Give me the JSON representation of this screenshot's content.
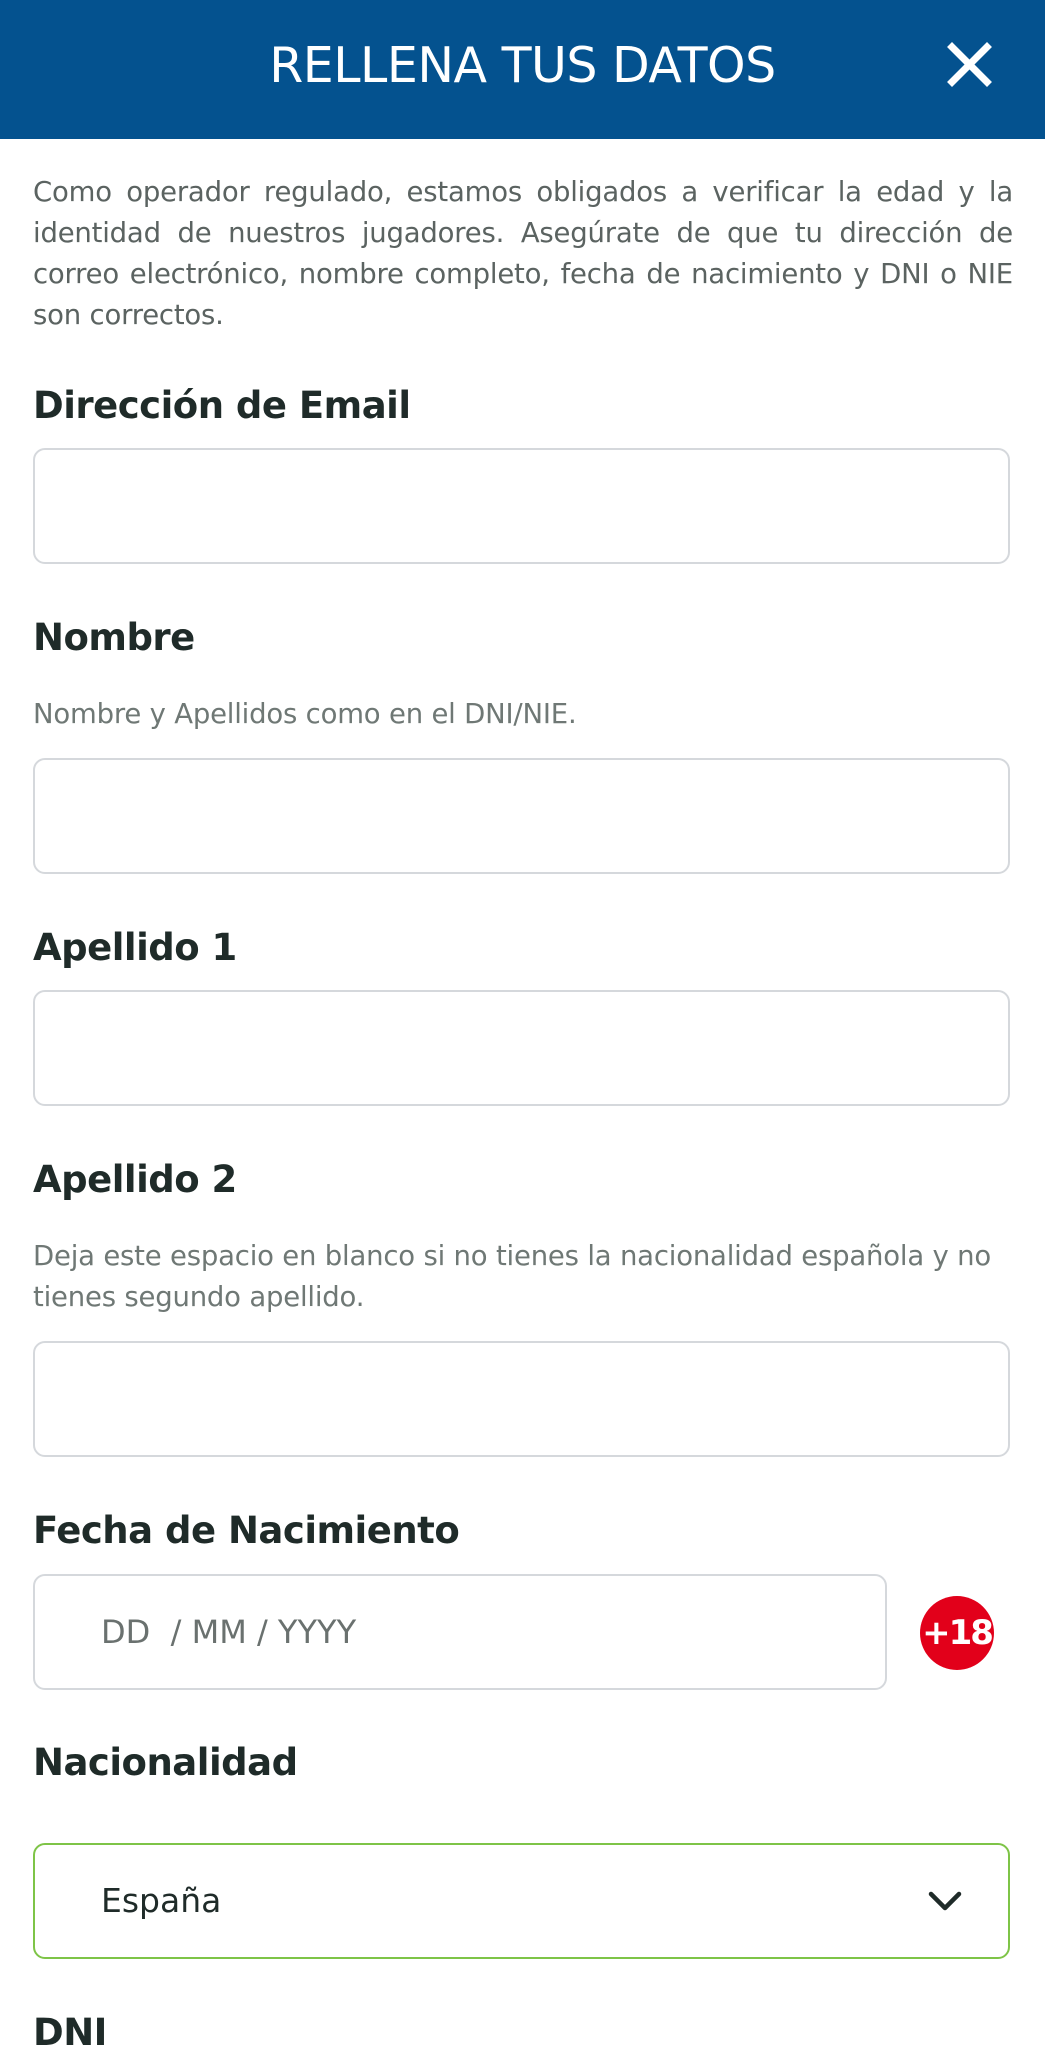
{
  "header": {
    "title": "RELLENA TUS DATOS"
  },
  "intro": {
    "text": "Como operador regulado, estamos obligados a verificar la edad y la identidad de nuestros jugadores. Asegúrate de que tu dirección de correo electrónico, nombre completo, fecha de nacimiento y DNI o NIE son correctos."
  },
  "form": {
    "email": {
      "label": "Dirección de Email",
      "value": ""
    },
    "nombre": {
      "label": "Nombre",
      "hint": "Nombre y Apellidos como en el DNI/NIE.",
      "value": ""
    },
    "apellido1": {
      "label": "Apellido 1",
      "value": ""
    },
    "apellido2": {
      "label": "Apellido 2",
      "hint": "Deja este espacio en blanco si no tienes la nacionalidad española y no tienes segundo apellido.",
      "value": ""
    },
    "fecha": {
      "label": "Fecha de Nacimiento",
      "placeholder": "DD  / MM / YYYY",
      "value": ""
    },
    "age_badge": "+18",
    "nacionalidad": {
      "label": "Nacionalidad",
      "selected": "España"
    },
    "dni": {
      "label": "DNI"
    }
  },
  "colors": {
    "header_bg": "#04528f",
    "badge_red": "#e2001a",
    "select_border": "#7ec447"
  },
  "icons": {
    "close": "close-icon",
    "chevron": "chevron-down-icon"
  }
}
